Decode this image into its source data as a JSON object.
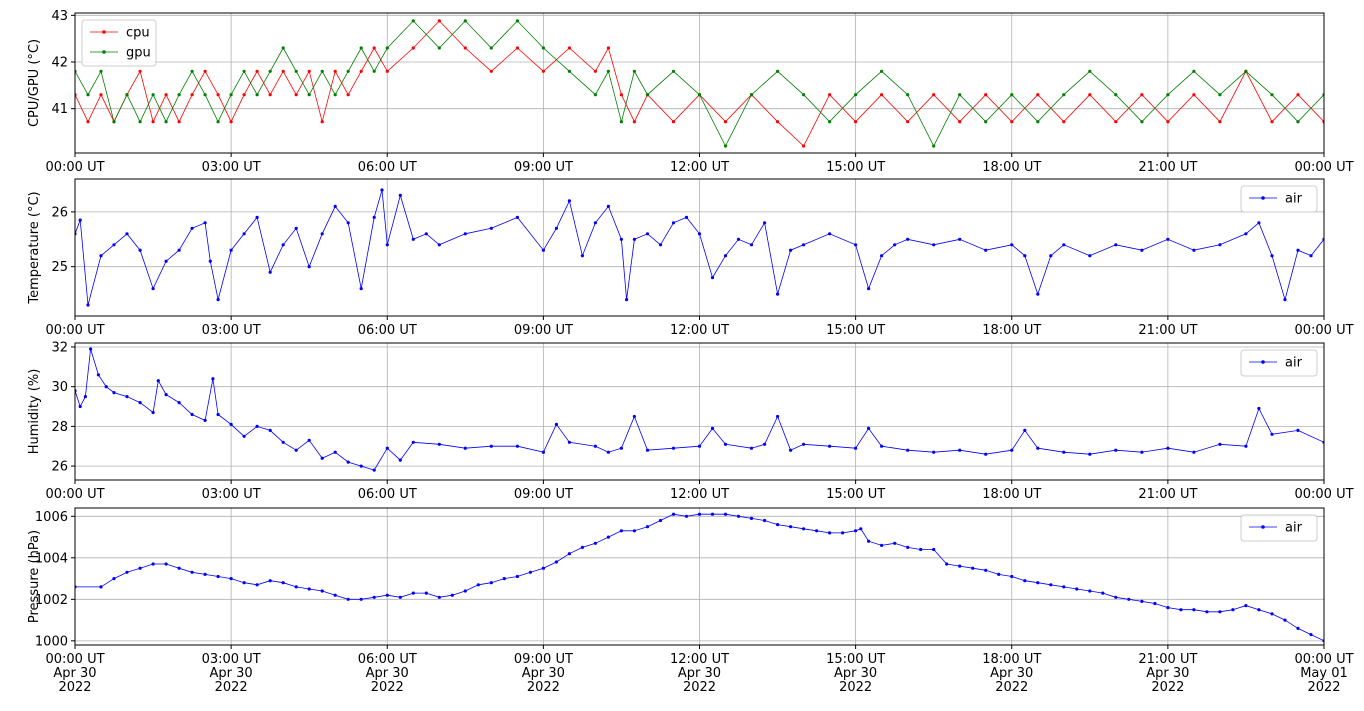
{
  "chart_data": [
    {
      "type": "line",
      "id": "cpu-gpu",
      "ylabel": "CPU/GPU (°C)",
      "ylim": [
        40.05,
        43.05
      ],
      "yticks": [
        41,
        42,
        43
      ],
      "xlim_hours": [
        0,
        24
      ],
      "xticks": [
        "00:00 UT",
        "03:00 UT",
        "06:00 UT",
        "09:00 UT",
        "12:00 UT",
        "15:00 UT",
        "18:00 UT",
        "21:00 UT",
        "00:00 UT"
      ],
      "grid": true,
      "legend": "upper left",
      "series": [
        {
          "name": "cpu",
          "color": "#ff0000",
          "x": [
            0,
            0.25,
            0.5,
            0.75,
            1.0,
            1.25,
            1.5,
            1.75,
            2.0,
            2.25,
            2.5,
            2.75,
            3.0,
            3.25,
            3.5,
            3.75,
            4.0,
            4.25,
            4.5,
            4.75,
            5.0,
            5.25,
            5.5,
            5.75,
            6.0,
            6.5,
            7.0,
            7.5,
            8.0,
            8.5,
            9.0,
            9.5,
            10.0,
            10.25,
            10.5,
            10.75,
            11.0,
            11.5,
            12.0,
            12.5,
            13.0,
            13.5,
            14.0,
            14.5,
            15.0,
            15.5,
            16.0,
            16.5,
            17.0,
            17.5,
            18.0,
            18.5,
            19.0,
            19.5,
            20.0,
            20.5,
            21.0,
            21.5,
            22.0,
            22.5,
            23.0,
            23.5,
            24.0
          ],
          "y": [
            41.3,
            40.72,
            41.3,
            40.72,
            41.3,
            41.8,
            40.72,
            41.3,
            40.72,
            41.3,
            41.8,
            41.3,
            40.72,
            41.3,
            41.8,
            41.3,
            41.8,
            41.3,
            41.8,
            40.72,
            41.8,
            41.3,
            41.8,
            42.3,
            41.8,
            42.3,
            42.88,
            42.3,
            41.8,
            42.3,
            41.8,
            42.3,
            41.8,
            42.3,
            41.3,
            40.72,
            41.3,
            40.72,
            41.3,
            40.72,
            41.3,
            40.72,
            40.2,
            41.3,
            40.72,
            41.3,
            40.72,
            41.3,
            40.72,
            41.3,
            40.72,
            41.3,
            40.72,
            41.3,
            40.72,
            41.3,
            40.72,
            41.3,
            40.72,
            41.8,
            40.72,
            41.3,
            40.72
          ]
        },
        {
          "name": "gpu",
          "color": "#008000",
          "x": [
            0,
            0.25,
            0.5,
            0.75,
            1.0,
            1.25,
            1.5,
            1.75,
            2.0,
            2.25,
            2.5,
            2.75,
            3.0,
            3.25,
            3.5,
            3.75,
            4.0,
            4.25,
            4.5,
            4.75,
            5.0,
            5.25,
            5.5,
            5.75,
            6.0,
            6.5,
            7.0,
            7.5,
            8.0,
            8.5,
            9.0,
            9.5,
            10.0,
            10.25,
            10.5,
            10.75,
            11.0,
            11.5,
            12.0,
            12.5,
            13.0,
            13.5,
            14.0,
            14.5,
            15.0,
            15.5,
            16.0,
            16.5,
            17.0,
            17.5,
            18.0,
            18.5,
            19.0,
            19.5,
            20.0,
            20.5,
            21.0,
            21.5,
            22.0,
            22.5,
            23.0,
            23.5,
            24.0
          ],
          "y": [
            41.8,
            41.3,
            41.8,
            40.72,
            41.3,
            40.72,
            41.3,
            40.72,
            41.3,
            41.8,
            41.3,
            40.72,
            41.3,
            41.8,
            41.3,
            41.8,
            42.3,
            41.8,
            41.3,
            41.8,
            41.3,
            41.8,
            42.3,
            41.8,
            42.3,
            42.88,
            42.3,
            42.88,
            42.3,
            42.88,
            42.3,
            41.8,
            41.3,
            41.8,
            40.72,
            41.8,
            41.3,
            41.8,
            41.3,
            40.2,
            41.3,
            41.8,
            41.3,
            40.72,
            41.3,
            41.8,
            41.3,
            40.2,
            41.3,
            40.72,
            41.3,
            40.72,
            41.3,
            41.8,
            41.3,
            40.72,
            41.3,
            41.8,
            41.3,
            41.8,
            41.3,
            40.72,
            41.3
          ]
        }
      ]
    },
    {
      "type": "line",
      "id": "temperature",
      "ylabel": "Temperature (°C)",
      "ylim": [
        24.1,
        26.6
      ],
      "yticks": [
        25,
        26
      ],
      "xlim_hours": [
        0,
        24
      ],
      "xticks": [
        "00:00 UT",
        "03:00 UT",
        "06:00 UT",
        "09:00 UT",
        "12:00 UT",
        "15:00 UT",
        "18:00 UT",
        "21:00 UT",
        "00:00 UT"
      ],
      "grid": true,
      "legend": "upper right",
      "series": [
        {
          "name": "air",
          "color": "#0000ff",
          "x": [
            0,
            0.1,
            0.25,
            0.5,
            0.75,
            1.0,
            1.25,
            1.5,
            1.75,
            2.0,
            2.25,
            2.5,
            2.6,
            2.75,
            3.0,
            3.25,
            3.5,
            3.75,
            4.0,
            4.25,
            4.5,
            4.75,
            5.0,
            5.25,
            5.5,
            5.75,
            5.9,
            6.0,
            6.25,
            6.5,
            6.75,
            7.0,
            7.5,
            8.0,
            8.5,
            9.0,
            9.25,
            9.5,
            9.75,
            10.0,
            10.25,
            10.5,
            10.6,
            10.75,
            11.0,
            11.25,
            11.5,
            11.75,
            12.0,
            12.25,
            12.5,
            12.75,
            13.0,
            13.25,
            13.5,
            13.75,
            14.0,
            14.5,
            15.0,
            15.25,
            15.5,
            15.75,
            16.0,
            16.5,
            17.0,
            17.5,
            18.0,
            18.25,
            18.5,
            18.75,
            19.0,
            19.5,
            20.0,
            20.5,
            21.0,
            21.5,
            22.0,
            22.5,
            22.75,
            23.0,
            23.25,
            23.5,
            23.75,
            24.0
          ],
          "y": [
            25.6,
            25.85,
            24.3,
            25.2,
            25.4,
            25.6,
            25.3,
            24.6,
            25.1,
            25.3,
            25.7,
            25.8,
            25.1,
            24.4,
            25.3,
            25.6,
            25.9,
            24.9,
            25.4,
            25.7,
            25.0,
            25.6,
            26.1,
            25.8,
            24.6,
            25.9,
            26.4,
            25.4,
            26.3,
            25.5,
            25.6,
            25.4,
            25.6,
            25.7,
            25.9,
            25.3,
            25.7,
            26.2,
            25.2,
            25.8,
            26.1,
            25.5,
            24.4,
            25.5,
            25.6,
            25.4,
            25.8,
            25.9,
            25.6,
            24.8,
            25.2,
            25.5,
            25.4,
            25.8,
            24.5,
            25.3,
            25.4,
            25.6,
            25.4,
            24.6,
            25.2,
            25.4,
            25.5,
            25.4,
            25.5,
            25.3,
            25.4,
            25.2,
            24.5,
            25.2,
            25.4,
            25.2,
            25.4,
            25.3,
            25.5,
            25.3,
            25.4,
            25.6,
            25.8,
            25.2,
            24.4,
            25.3,
            25.2,
            25.5
          ]
        }
      ]
    },
    {
      "type": "line",
      "id": "humidity",
      "ylabel": "Humidity (%)",
      "ylim": [
        25.3,
        32.2
      ],
      "yticks": [
        26,
        28,
        30,
        32
      ],
      "xlim_hours": [
        0,
        24
      ],
      "xticks": [
        "00:00 UT",
        "03:00 UT",
        "06:00 UT",
        "09:00 UT",
        "12:00 UT",
        "15:00 UT",
        "18:00 UT",
        "21:00 UT",
        "00:00 UT"
      ],
      "grid": true,
      "legend": "upper right",
      "series": [
        {
          "name": "air",
          "color": "#0000ff",
          "x": [
            0,
            0.1,
            0.2,
            0.3,
            0.45,
            0.6,
            0.75,
            1.0,
            1.25,
            1.5,
            1.6,
            1.75,
            2.0,
            2.25,
            2.5,
            2.65,
            2.75,
            3.0,
            3.25,
            3.5,
            3.75,
            4.0,
            4.25,
            4.5,
            4.75,
            5.0,
            5.25,
            5.5,
            5.75,
            6.0,
            6.25,
            6.5,
            7.0,
            7.5,
            8.0,
            8.5,
            9.0,
            9.25,
            9.5,
            10.0,
            10.25,
            10.5,
            10.75,
            11.0,
            11.5,
            12.0,
            12.25,
            12.5,
            13.0,
            13.25,
            13.5,
            13.75,
            14.0,
            14.5,
            15.0,
            15.25,
            15.5,
            16.0,
            16.5,
            17.0,
            17.5,
            18.0,
            18.25,
            18.5,
            19.0,
            19.5,
            20.0,
            20.5,
            21.0,
            21.5,
            22.0,
            22.5,
            22.75,
            23.0,
            23.5,
            24.0
          ],
          "y": [
            29.8,
            29.0,
            29.5,
            31.9,
            30.6,
            30.0,
            29.7,
            29.5,
            29.2,
            28.7,
            30.3,
            29.6,
            29.2,
            28.6,
            28.3,
            30.4,
            28.6,
            28.1,
            27.5,
            28.0,
            27.8,
            27.2,
            26.8,
            27.3,
            26.4,
            26.7,
            26.2,
            26.0,
            25.8,
            26.9,
            26.3,
            27.2,
            27.1,
            26.9,
            27.0,
            27.0,
            26.7,
            28.1,
            27.2,
            27.0,
            26.7,
            26.9,
            28.5,
            26.8,
            26.9,
            27.0,
            27.9,
            27.1,
            26.9,
            27.1,
            28.5,
            26.8,
            27.1,
            27.0,
            26.9,
            27.9,
            27.0,
            26.8,
            26.7,
            26.8,
            26.6,
            26.8,
            27.8,
            26.9,
            26.7,
            26.6,
            26.8,
            26.7,
            26.9,
            26.7,
            27.1,
            27.0,
            28.9,
            27.6,
            27.8,
            27.2
          ]
        }
      ]
    },
    {
      "type": "line",
      "id": "pressure",
      "ylabel": "Pressure (hPa)",
      "ylim": [
        999.8,
        1006.4
      ],
      "yticks": [
        1000,
        1002,
        1004,
        1006
      ],
      "xlim_hours": [
        0,
        24
      ],
      "xticks": [
        "00:00 UT\nApr 30\n2022",
        "03:00 UT\nApr 30\n2022",
        "06:00 UT\nApr 30\n2022",
        "09:00 UT\nApr 30\n2022",
        "12:00 UT\nApr 30\n2022",
        "15:00 UT\nApr 30\n2022",
        "18:00 UT\nApr 30\n2022",
        "21:00 UT\nApr 30\n2022",
        "00:00 UT\nMay 01\n2022"
      ],
      "grid": true,
      "legend": "upper right",
      "series": [
        {
          "name": "air",
          "color": "#0000ff",
          "x": [
            0,
            0.5,
            0.75,
            1.0,
            1.25,
            1.5,
            1.75,
            2.0,
            2.25,
            2.5,
            2.75,
            3.0,
            3.25,
            3.5,
            3.75,
            4.0,
            4.25,
            4.5,
            4.75,
            5.0,
            5.25,
            5.5,
            5.75,
            6.0,
            6.25,
            6.5,
            6.75,
            7.0,
            7.25,
            7.5,
            7.75,
            8.0,
            8.25,
            8.5,
            8.75,
            9.0,
            9.25,
            9.5,
            9.75,
            10.0,
            10.25,
            10.5,
            10.75,
            11.0,
            11.25,
            11.5,
            11.75,
            12.0,
            12.25,
            12.5,
            12.75,
            13.0,
            13.25,
            13.5,
            13.75,
            14.0,
            14.25,
            14.5,
            14.75,
            15.0,
            15.1,
            15.25,
            15.5,
            15.75,
            16.0,
            16.25,
            16.5,
            16.75,
            17.0,
            17.25,
            17.5,
            17.75,
            18.0,
            18.25,
            18.5,
            18.75,
            19.0,
            19.25,
            19.5,
            19.75,
            20.0,
            20.25,
            20.5,
            20.75,
            21.0,
            21.25,
            21.5,
            21.75,
            22.0,
            22.25,
            22.5,
            22.75,
            23.0,
            23.25,
            23.5,
            23.75,
            24.0
          ],
          "y": [
            1002.6,
            1002.6,
            1003.0,
            1003.3,
            1003.5,
            1003.7,
            1003.7,
            1003.5,
            1003.3,
            1003.2,
            1003.1,
            1003.0,
            1002.8,
            1002.7,
            1002.9,
            1002.8,
            1002.6,
            1002.5,
            1002.4,
            1002.2,
            1002.0,
            1002.0,
            1002.1,
            1002.2,
            1002.1,
            1002.3,
            1002.3,
            1002.1,
            1002.2,
            1002.4,
            1002.7,
            1002.8,
            1003.0,
            1003.1,
            1003.3,
            1003.5,
            1003.8,
            1004.2,
            1004.5,
            1004.7,
            1005.0,
            1005.3,
            1005.3,
            1005.5,
            1005.8,
            1006.1,
            1006.0,
            1006.1,
            1006.1,
            1006.1,
            1006.0,
            1005.9,
            1005.8,
            1005.6,
            1005.5,
            1005.4,
            1005.3,
            1005.2,
            1005.2,
            1005.3,
            1005.4,
            1004.8,
            1004.6,
            1004.7,
            1004.5,
            1004.4,
            1004.4,
            1003.7,
            1003.6,
            1003.5,
            1003.4,
            1003.2,
            1003.1,
            1002.9,
            1002.8,
            1002.7,
            1002.6,
            1002.5,
            1002.4,
            1002.3,
            1002.1,
            1002.0,
            1001.9,
            1001.8,
            1001.6,
            1001.5,
            1001.5,
            1001.4,
            1001.4,
            1001.5,
            1001.7,
            1001.5,
            1001.3,
            1001.0,
            1000.6,
            1000.3,
            1000.0
          ]
        }
      ]
    }
  ]
}
